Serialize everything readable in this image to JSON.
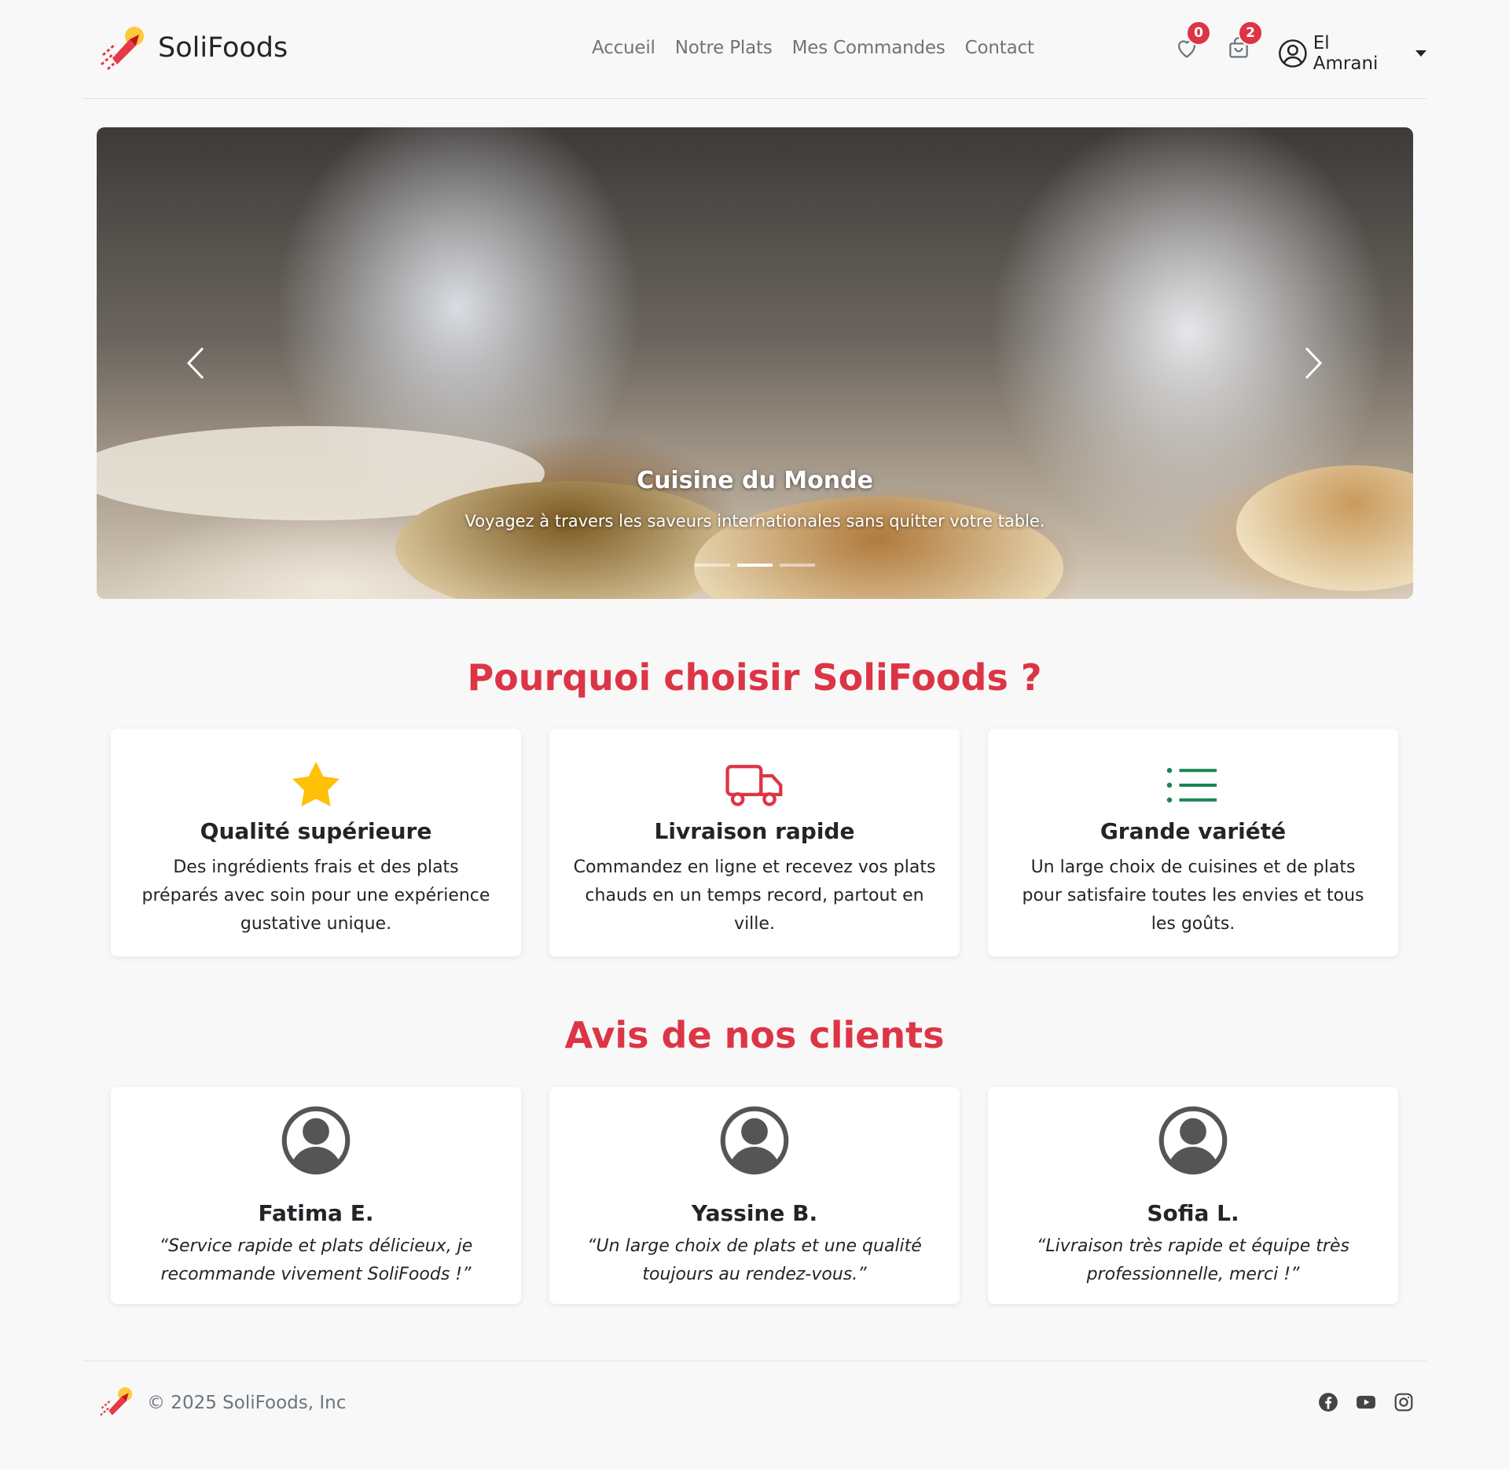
{
  "brand": {
    "name": "SoliFoods",
    "logo_icon": "rocket-logo-icon"
  },
  "nav": {
    "items": [
      "Accueil",
      "Notre Plats",
      "Mes Commandes",
      "Contact"
    ]
  },
  "header": {
    "wishlist_count": "0",
    "cart_count": "2",
    "user_name": "El Amrani"
  },
  "carousel": {
    "title": "Cuisine du Monde",
    "text": "Voyagez à travers les saveurs internationales sans quitter votre table.",
    "slide_count": 3,
    "active_slide": 2
  },
  "features": {
    "title": "Pourquoi choisir SoliFoods ?",
    "items": [
      {
        "icon": "star-icon",
        "color": "#ffc107",
        "title": "Qualité supérieure",
        "text": "Des ingrédients frais et des plats préparés avec soin pour une expérience gustative unique."
      },
      {
        "icon": "truck-icon",
        "color": "#dc3545",
        "title": "Livraison rapide",
        "text": "Commandez en ligne et recevez vos plats chauds en un temps record, partout en ville."
      },
      {
        "icon": "list-icon",
        "color": "#198754",
        "title": "Grande variété",
        "text": "Un large choix de cuisines et de plats pour satisfaire toutes les envies et tous les goûts."
      }
    ]
  },
  "reviews": {
    "title": "Avis de nos clients",
    "items": [
      {
        "name": "Fatima E.",
        "text": "“Service rapide et plats délicieux, je recommande vivement SoliFoods !”"
      },
      {
        "name": "Yassine B.",
        "text": "“Un large choix de plats et une qualité toujours au rendez-vous.”"
      },
      {
        "name": "Sofia L.",
        "text": "“Livraison très rapide et équipe très professionnelle, merci !”"
      }
    ]
  },
  "footer": {
    "copyright": "© 2025 SoliFoods, Inc",
    "social": [
      "facebook-icon",
      "youtube-icon",
      "instagram-icon"
    ]
  },
  "colors": {
    "accent": "#dc3545",
    "star": "#ffc107",
    "green": "#198754",
    "muted": "#6c757d"
  }
}
